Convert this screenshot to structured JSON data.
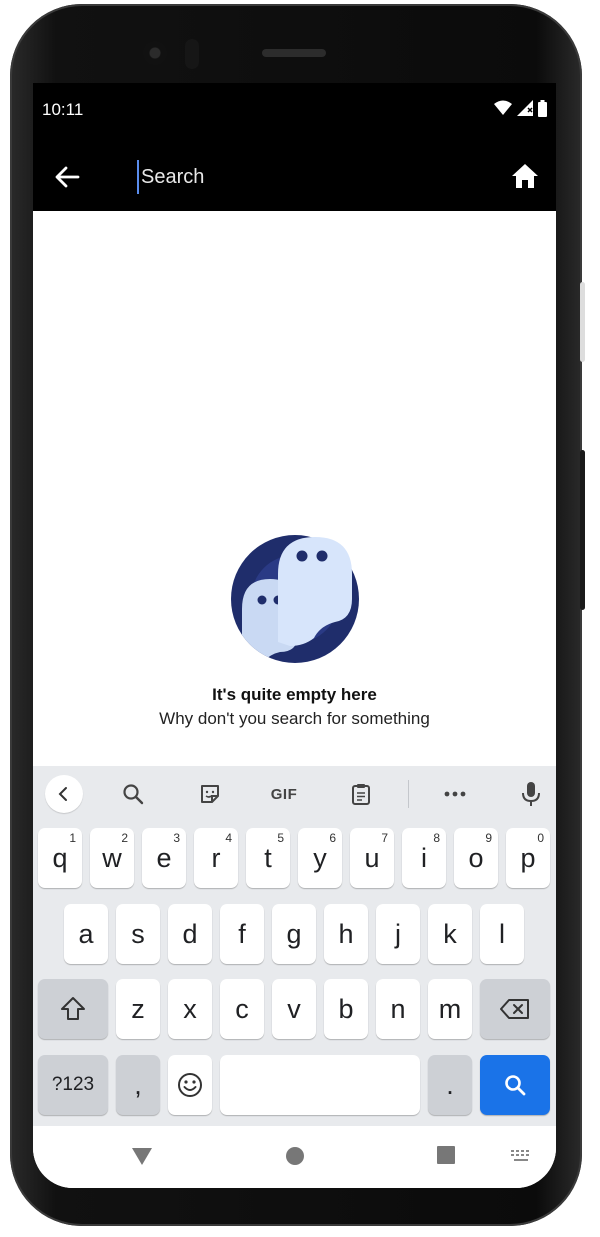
{
  "status_bar": {
    "time": "10:11"
  },
  "search": {
    "placeholder": "Search",
    "value": ""
  },
  "empty_state": {
    "title": "It's quite empty here",
    "subtitle": "Why don't you search for something"
  },
  "keyboard": {
    "toolbar": {
      "gif_label": "GIF"
    },
    "row1": [
      {
        "letter": "q",
        "num": "1"
      },
      {
        "letter": "w",
        "num": "2"
      },
      {
        "letter": "e",
        "num": "3"
      },
      {
        "letter": "r",
        "num": "4"
      },
      {
        "letter": "t",
        "num": "5"
      },
      {
        "letter": "y",
        "num": "6"
      },
      {
        "letter": "u",
        "num": "7"
      },
      {
        "letter": "i",
        "num": "8"
      },
      {
        "letter": "o",
        "num": "9"
      },
      {
        "letter": "p",
        "num": "0"
      }
    ],
    "row2": [
      "a",
      "s",
      "d",
      "f",
      "g",
      "h",
      "j",
      "k",
      "l"
    ],
    "row3": [
      "z",
      "x",
      "c",
      "v",
      "b",
      "n",
      "m"
    ],
    "symbols_label": "?123",
    "comma_label": ",",
    "period_label": "."
  },
  "colors": {
    "accent": "#1a73e8",
    "app_bar": "#000000",
    "keyboard_bg": "#e8eaed"
  }
}
